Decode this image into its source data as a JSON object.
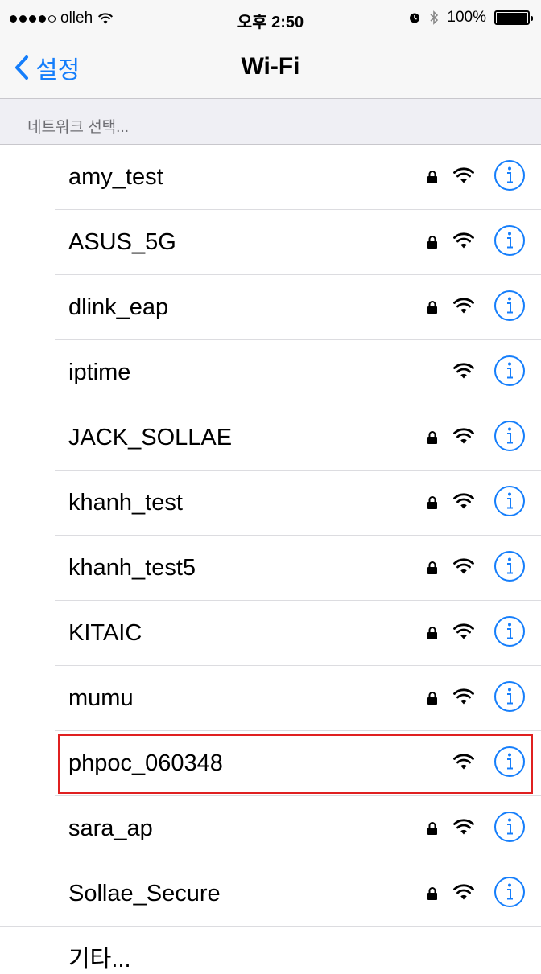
{
  "status_bar": {
    "carrier": "olleh",
    "time": "오후 2:50",
    "battery": "100%"
  },
  "nav": {
    "back_label": "설정",
    "title": "Wi-Fi"
  },
  "section_header": "네트워크 선택...",
  "networks": [
    {
      "name": "amy_test",
      "secured": true
    },
    {
      "name": "ASUS_5G",
      "secured": true
    },
    {
      "name": "dlink_eap",
      "secured": true
    },
    {
      "name": "iptime",
      "secured": false
    },
    {
      "name": "JACK_SOLLAE",
      "secured": true
    },
    {
      "name": "khanh_test",
      "secured": true
    },
    {
      "name": "khanh_test5",
      "secured": true
    },
    {
      "name": "KITAIC",
      "secured": true
    },
    {
      "name": "mumu",
      "secured": true
    },
    {
      "name": "phpoc_060348",
      "secured": false,
      "highlighted": true
    },
    {
      "name": "sara_ap",
      "secured": true
    },
    {
      "name": "Sollae_Secure",
      "secured": true
    }
  ],
  "other_label": "기타...",
  "colors": {
    "accent": "#157efb",
    "highlight_border": "#e02020"
  }
}
